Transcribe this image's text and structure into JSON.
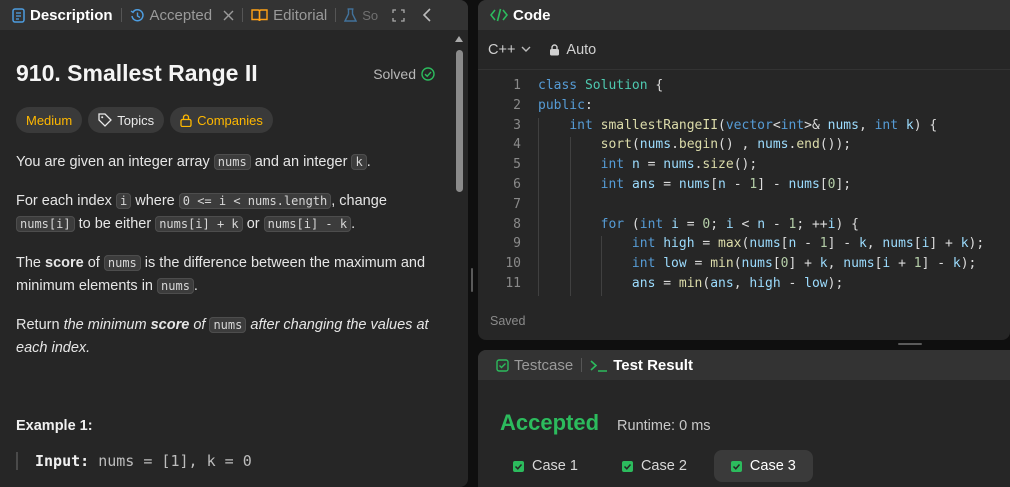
{
  "left_tabs": [
    {
      "label": "Description",
      "active": true
    },
    {
      "label": "Accepted"
    },
    {
      "label": "Editorial"
    },
    {
      "label": "So"
    }
  ],
  "problem": {
    "title": "910. Smallest Range II",
    "solved_label": "Solved",
    "badges": {
      "difficulty": "Medium",
      "topics": "Topics",
      "companies": "Companies"
    },
    "p1": {
      "a": "You are given an integer array ",
      "c1": "nums",
      "b": " and an integer ",
      "c2": "k",
      "d": "."
    },
    "p2": {
      "a": "For each index ",
      "c1": "i",
      "b": " where ",
      "c2": "0 <= i < nums.length",
      "d": ", change ",
      "c3": "nums[i]",
      "e": " to be either ",
      "c4": "nums[i] + k",
      "f": " or ",
      "c5": "nums[i] - k",
      "g": "."
    },
    "p3": {
      "a": "The ",
      "bold": "score",
      "b": " of ",
      "c1": "nums",
      "c": " is the difference between the maximum and minimum elements in ",
      "c2": "nums",
      "d": "."
    },
    "p4": {
      "a": "Return ",
      "i1": "the minimum ",
      "bold": "score",
      "i2": " of ",
      "c1": "nums",
      "i3": " after changing the values at each index."
    },
    "example_title": "Example 1:",
    "example_input_label": "Input:",
    "example_input_value": "nums = [1], k = 0"
  },
  "code_panel": {
    "title": "Code",
    "language": "C++",
    "mode": "Auto",
    "saved_label": "Saved",
    "lines": [
      {
        "n": "1",
        "text": "class Solution {"
      },
      {
        "n": "2",
        "text": "public:"
      },
      {
        "n": "3",
        "text": "    int smallestRangeII(vector<int>& nums, int k) {"
      },
      {
        "n": "4",
        "text": "        sort(nums.begin() , nums.end());"
      },
      {
        "n": "5",
        "text": "        int n = nums.size();"
      },
      {
        "n": "6",
        "text": "        int ans = nums[n - 1] - nums[0];"
      },
      {
        "n": "7",
        "text": ""
      },
      {
        "n": "8",
        "text": "        for (int i = 0; i < n - 1; ++i) {"
      },
      {
        "n": "9",
        "text": "            int high = max(nums[n - 1] - k, nums[i] + k);"
      },
      {
        "n": "10",
        "text": "            int low = min(nums[0] + k, nums[i + 1] - k);"
      },
      {
        "n": "11",
        "text": "            ans = min(ans, high - low);"
      }
    ]
  },
  "result_panel": {
    "tabs": [
      {
        "label": "Testcase"
      },
      {
        "label": "Test Result",
        "active": true
      }
    ],
    "status": "Accepted",
    "runtime": "Runtime: 0 ms",
    "cases": [
      {
        "label": "Case 1"
      },
      {
        "label": "Case 2"
      },
      {
        "label": "Case 3",
        "active": true
      }
    ]
  },
  "colors": {
    "accent_green": "#2cbb5d",
    "medium": "#ffb800",
    "panel": "#262626",
    "tabbar": "#333333"
  }
}
